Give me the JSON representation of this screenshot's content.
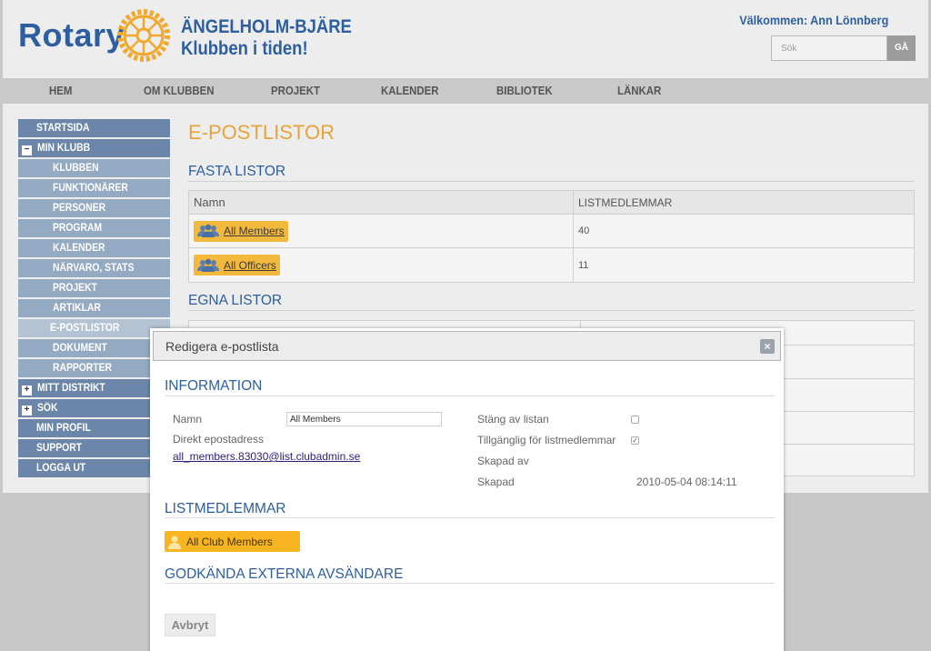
{
  "header": {
    "logo_text": "Rotary",
    "club_name_line1": "ÄNGELHOLM-BJÄRE",
    "club_name_line2": "Klubben i tiden!",
    "welcome": "Välkommen: Ann Lönnberg",
    "search_placeholder": "Sök",
    "search_button": "GÅ"
  },
  "nav": [
    "HEM",
    "OM KLUBBEN",
    "PROJEKT",
    "KALENDER",
    "BIBLIOTEK",
    "LÄNKAR"
  ],
  "sidebar": {
    "startsida": "STARTSIDA",
    "min_klubb": "MIN KLUBB",
    "sub_items": [
      "KLUBBEN",
      "FUNKTIONÄRER",
      "PERSONER",
      "PROGRAM",
      "KALENDER",
      "NÄRVARO, STATS",
      "PROJEKT",
      "ARTIKLAR"
    ],
    "active_item": "E-POSTLISTOR",
    "sub_items_after": [
      "DOKUMENT",
      "RAPPORTER"
    ],
    "mitt_distrikt": "MITT DISTRIKT",
    "sok": "SÖK",
    "bottom_items": [
      "MIN PROFIL",
      "SUPPORT",
      "LOGGA UT"
    ]
  },
  "main": {
    "title": "E-POSTLISTOR",
    "fasta_heading": "FASTA LISTOR",
    "egna_heading": "EGNA LISTOR",
    "table": {
      "col_name": "Namn",
      "col_members": "LISTMEDLEMMAR",
      "rows": [
        {
          "name": "All Members",
          "members": "40"
        },
        {
          "name": "All Officers",
          "members": "11"
        }
      ]
    }
  },
  "modal": {
    "title": "Redigera e-postlista",
    "info_heading": "INFORMATION",
    "name_label": "Namn",
    "name_value": "All Members",
    "email_label": "Direkt epostadress",
    "email_value": "all_members.83030@list.clubadmin.se",
    "close_list_label": "Stäng av listan",
    "available_label": "Tillgänglig för listmedlemmar",
    "created_by_label": "Skapad av",
    "created_label": "Skapad",
    "created_value": "2010-05-04 08:14:11",
    "members_heading": "LISTMEDLEMMAR",
    "member_tag": "All Club Members",
    "senders_heading": "GODKÄNDA EXTERNA AVSÄNDARE",
    "cancel_button": "Avbryt",
    "close_list_checked": false,
    "available_checked": true
  },
  "colors": {
    "brand_blue": "#2d5fa0",
    "accent_gold": "#e8a33d",
    "sidebar_blue": "#6b86a8"
  }
}
